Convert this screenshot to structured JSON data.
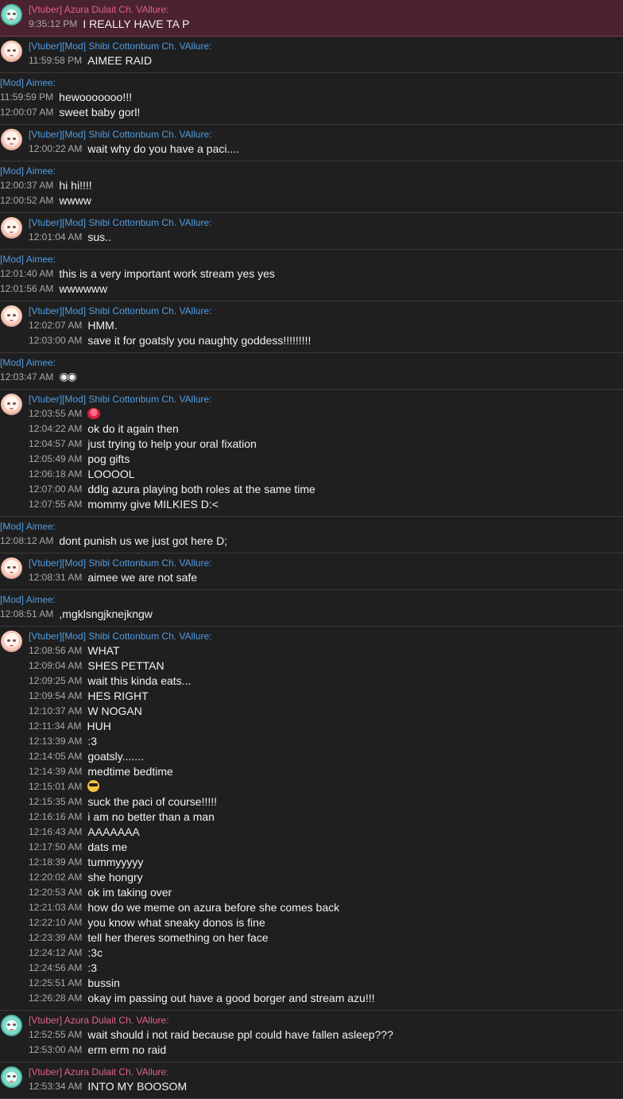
{
  "users": {
    "azura": {
      "tag": "[Vtuber]",
      "name": "Azura Dulait Ch. VAllure:"
    },
    "shibi": {
      "tag": "[Vtuber][Mod]",
      "name": "Shibi Cottonbum Ch. VAllure:"
    },
    "aimee": {
      "tag": "[Mod]",
      "name": "Aimee:"
    }
  },
  "groups": [
    {
      "user": "azura",
      "highlight": true,
      "lines": [
        {
          "time": "9:35:12 PM",
          "text": "I REALLY HAVE TA P"
        }
      ]
    },
    {
      "user": "shibi",
      "lines": [
        {
          "time": "11:59:58 PM",
          "text": "AIMEE RAID"
        }
      ]
    },
    {
      "user": "aimee",
      "lines": [
        {
          "time": "11:59:59 PM",
          "text": "hewooooooo!!!"
        },
        {
          "time": "12:00:07 AM",
          "text": "sweet baby gorl!"
        }
      ]
    },
    {
      "user": "shibi",
      "lines": [
        {
          "time": "12:00:22 AM",
          "text": "wait why do you have a paci...."
        }
      ]
    },
    {
      "user": "aimee",
      "lines": [
        {
          "time": "12:00:37 AM",
          "text": "hi hi!!!!"
        },
        {
          "time": "12:00:52 AM",
          "text": "wwww"
        }
      ]
    },
    {
      "user": "shibi",
      "lines": [
        {
          "time": "12:01:04 AM",
          "text": "sus.."
        }
      ]
    },
    {
      "user": "aimee",
      "lines": [
        {
          "time": "12:01:40 AM",
          "text": "this is a very important work stream yes yes"
        },
        {
          "time": "12:01:56 AM",
          "text": "wwwwww"
        }
      ]
    },
    {
      "user": "shibi",
      "lines": [
        {
          "time": "12:02:07 AM",
          "text": "HMM."
        },
        {
          "time": "12:03:00 AM",
          "text": "save it for goatsly you naughty goddess!!!!!!!!!"
        }
      ]
    },
    {
      "user": "aimee",
      "lines": [
        {
          "time": "12:03:47 AM",
          "text": "",
          "emoji": "eyes-emoji"
        }
      ]
    },
    {
      "user": "shibi",
      "lines": [
        {
          "time": "12:03:55 AM",
          "text": "",
          "emoji": "lips-emoji"
        },
        {
          "time": "12:04:22 AM",
          "text": "ok do it again then"
        },
        {
          "time": "12:04:57 AM",
          "text": "just trying to help your oral fixation"
        },
        {
          "time": "12:05:49 AM",
          "text": "pog gifts"
        },
        {
          "time": "12:06:18 AM",
          "text": "LOOOOL"
        },
        {
          "time": "12:07:00 AM",
          "text": "ddlg azura playing both roles at the same time"
        },
        {
          "time": "12:07:55 AM",
          "text": "mommy give MILKIES D:<"
        }
      ]
    },
    {
      "user": "aimee",
      "lines": [
        {
          "time": "12:08:12 AM",
          "text": "dont punish us we just got here D;"
        }
      ]
    },
    {
      "user": "shibi",
      "lines": [
        {
          "time": "12:08:31 AM",
          "text": "aimee we are not safe"
        }
      ]
    },
    {
      "user": "aimee",
      "lines": [
        {
          "time": "12:08:51 AM",
          "text": ",mgklsngjknejkngw"
        }
      ]
    },
    {
      "user": "shibi",
      "lines": [
        {
          "time": "12:08:56 AM",
          "text": "WHAT"
        },
        {
          "time": "12:09:04 AM",
          "text": "SHES PETTAN"
        },
        {
          "time": "12:09:25 AM",
          "text": "wait this kinda eats..."
        },
        {
          "time": "12:09:54 AM",
          "text": "HES RIGHT"
        },
        {
          "time": "12:10:37 AM",
          "text": "W NOGAN"
        },
        {
          "time": "12:11:34 AM",
          "text": "HUH"
        },
        {
          "time": "12:13:39 AM",
          "text": ":3"
        },
        {
          "time": "12:14:05 AM",
          "text": "goatsly......."
        },
        {
          "time": "12:14:39 AM",
          "text": "medtime bedtime"
        },
        {
          "time": "12:15:01 AM",
          "text": "",
          "emoji": "cool-emoji"
        },
        {
          "time": "12:15:35 AM",
          "text": "suck the paci of course!!!!!"
        },
        {
          "time": "12:16:16 AM",
          "text": "i am no better than a man"
        },
        {
          "time": "12:16:43 AM",
          "text": "AAAAAAA"
        },
        {
          "time": "12:17:50 AM",
          "text": "dats me"
        },
        {
          "time": "12:18:39 AM",
          "text": "tummyyyyy"
        },
        {
          "time": "12:20:02 AM",
          "text": "she hongry"
        },
        {
          "time": "12:20:53 AM",
          "text": "ok im taking over"
        },
        {
          "time": "12:21:03 AM",
          "text": "how do we meme on azura before she comes back"
        },
        {
          "time": "12:22:10 AM",
          "text": "you know what sneaky donos is fine"
        },
        {
          "time": "12:23:39 AM",
          "text": "tell her theres something on her face"
        },
        {
          "time": "12:24:12 AM",
          "text": ":3c"
        },
        {
          "time": "12:24:56 AM",
          "text": ":3"
        },
        {
          "time": "12:25:51 AM",
          "text": "bussin"
        },
        {
          "time": "12:26:28 AM",
          "text": "okay im passing out have a good borger and stream azu!!!"
        }
      ]
    },
    {
      "user": "azura",
      "lines": [
        {
          "time": "12:52:55 AM",
          "text": "wait should i not raid because ppl could have fallen asleep???"
        },
        {
          "time": "12:53:00 AM",
          "text": "erm erm no raid"
        }
      ]
    },
    {
      "user": "azura",
      "lines": [
        {
          "time": "12:53:34 AM",
          "text": "INTO MY BOOSOM"
        }
      ]
    }
  ]
}
